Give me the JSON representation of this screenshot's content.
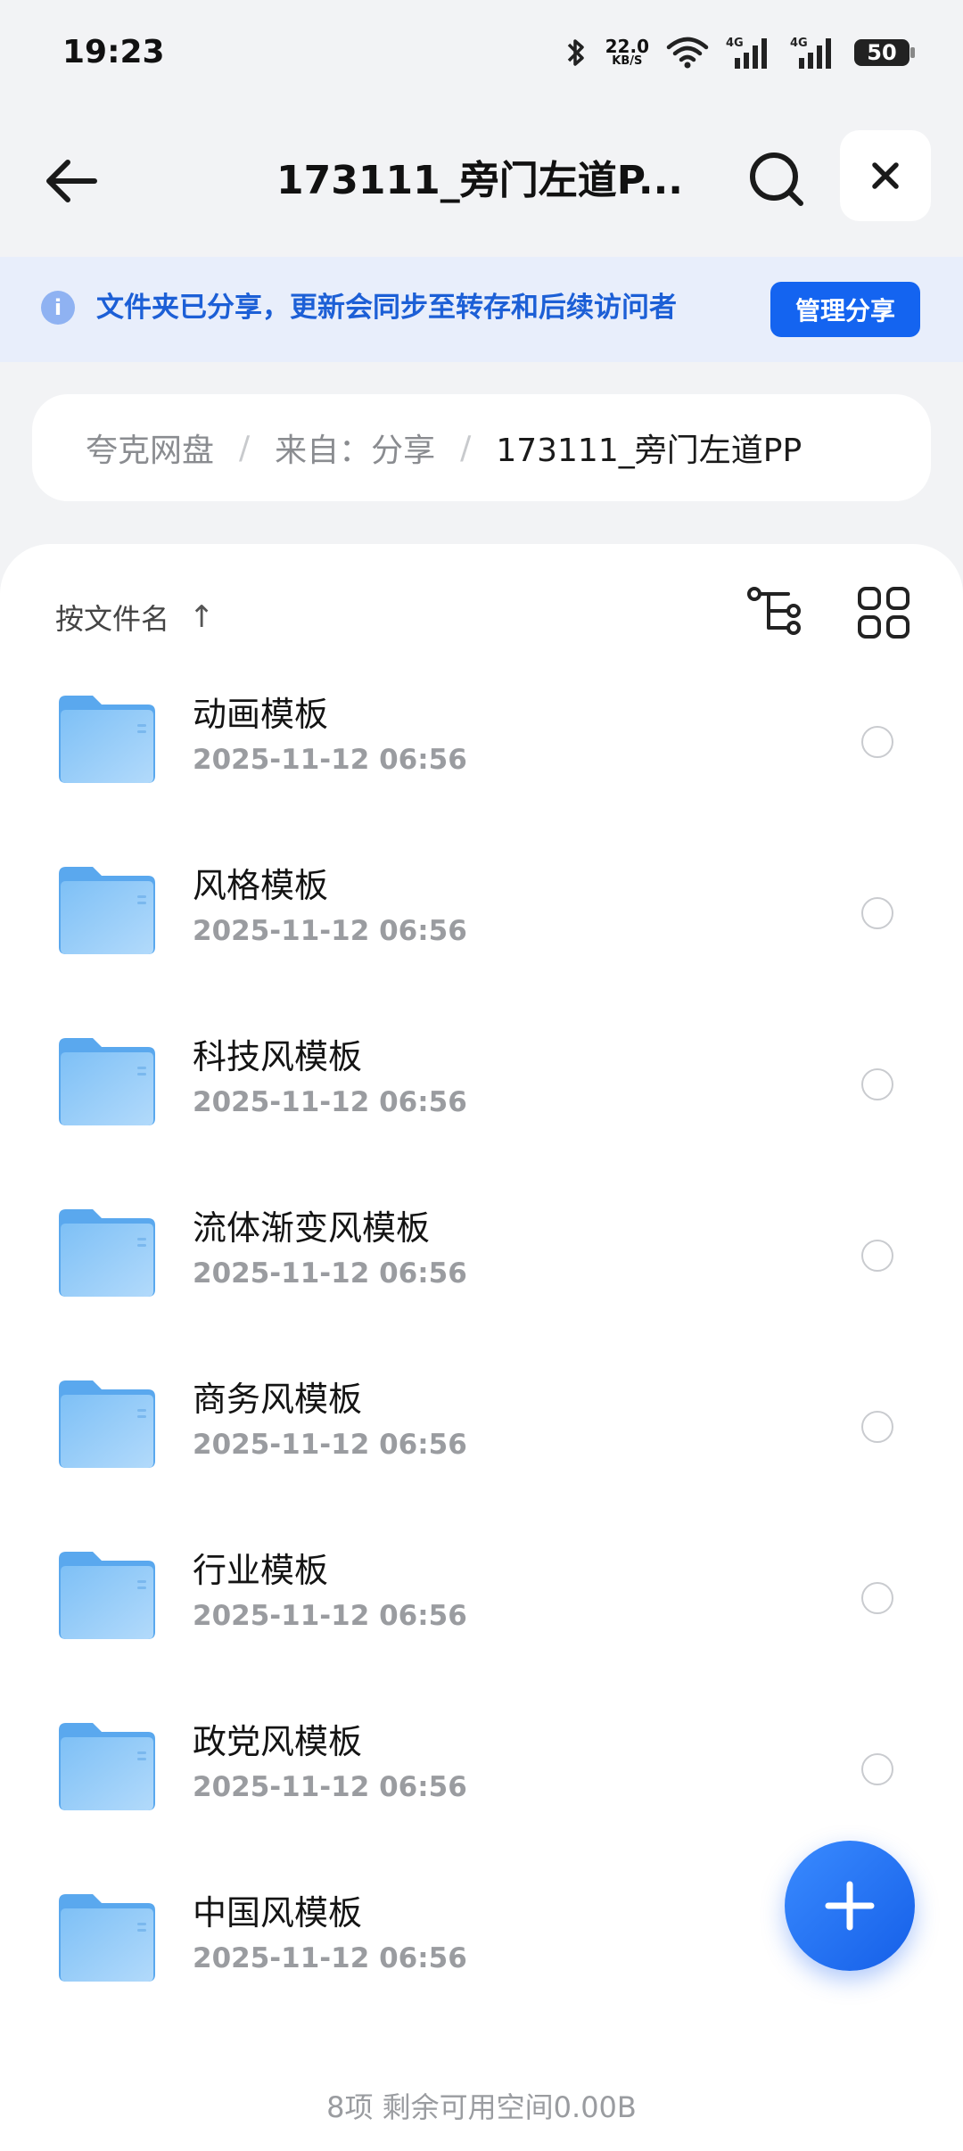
{
  "status_bar": {
    "time": "19:23",
    "net_speed": "22.0",
    "net_unit": "KB/S",
    "battery": "50"
  },
  "top_bar": {
    "title": "173111_旁门左道P..."
  },
  "share_banner": {
    "text": "文件夹已分享，更新会同步至转存和后续访问者",
    "manage_label": "管理分享",
    "info_glyph": "i",
    "accent_color": "#1464f0"
  },
  "breadcrumb": {
    "root": "夸克网盘",
    "middle": "来自：分享",
    "current": "173111_旁门左道PP"
  },
  "sort": {
    "label": "按文件名",
    "direction_glyph": "↑"
  },
  "files": [
    {
      "name": "动画模板",
      "date": "2025-11-12 06:56",
      "icon": "folder-icon"
    },
    {
      "name": "风格模板",
      "date": "2025-11-12 06:56",
      "icon": "folder-icon"
    },
    {
      "name": "科技风模板",
      "date": "2025-11-12 06:56",
      "icon": "folder-icon"
    },
    {
      "name": "流体渐变风模板",
      "date": "2025-11-12 06:56",
      "icon": "folder-icon"
    },
    {
      "name": "商务风模板",
      "date": "2025-11-12 06:56",
      "icon": "folder-icon"
    },
    {
      "name": "行业模板",
      "date": "2025-11-12 06:56",
      "icon": "folder-icon"
    },
    {
      "name": "政党风模板",
      "date": "2025-11-12 06:56",
      "icon": "folder-icon"
    },
    {
      "name": "中国风模板",
      "date": "2025-11-12 06:56",
      "icon": "folder-icon"
    }
  ],
  "footer": {
    "summary": "8项 剩余可用空间0.00B"
  }
}
